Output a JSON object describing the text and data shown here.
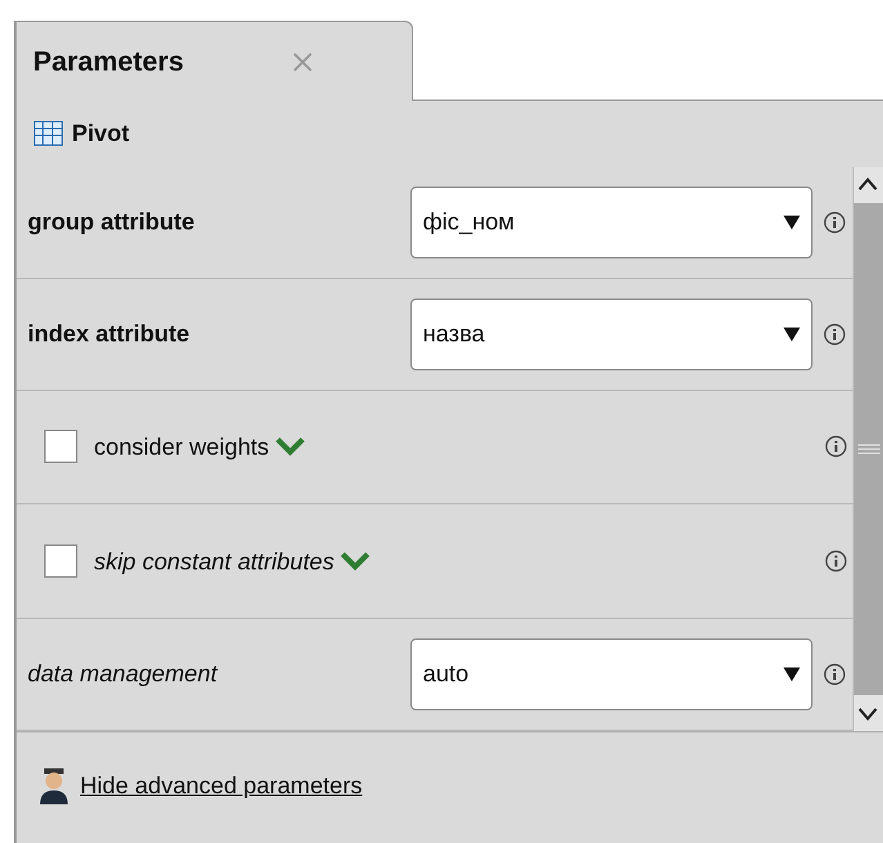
{
  "tab": {
    "title": "Parameters",
    "selected": true
  },
  "operator": {
    "name": "Pivot"
  },
  "parameters": [
    {
      "kind": "select",
      "label": "group attribute",
      "required": true,
      "expert": false,
      "value": "фіс_ном"
    },
    {
      "kind": "select",
      "label": "index attribute",
      "required": true,
      "expert": false,
      "value": "назва"
    },
    {
      "kind": "checkbox",
      "label": "consider weights",
      "required": false,
      "expert": false,
      "checked": false
    },
    {
      "kind": "checkbox",
      "label": "skip constant attributes",
      "required": false,
      "expert": true,
      "checked": false
    },
    {
      "kind": "select",
      "label": "data management",
      "required": false,
      "expert": true,
      "value": "auto"
    }
  ],
  "footer_link": "Hide advanced parameters"
}
